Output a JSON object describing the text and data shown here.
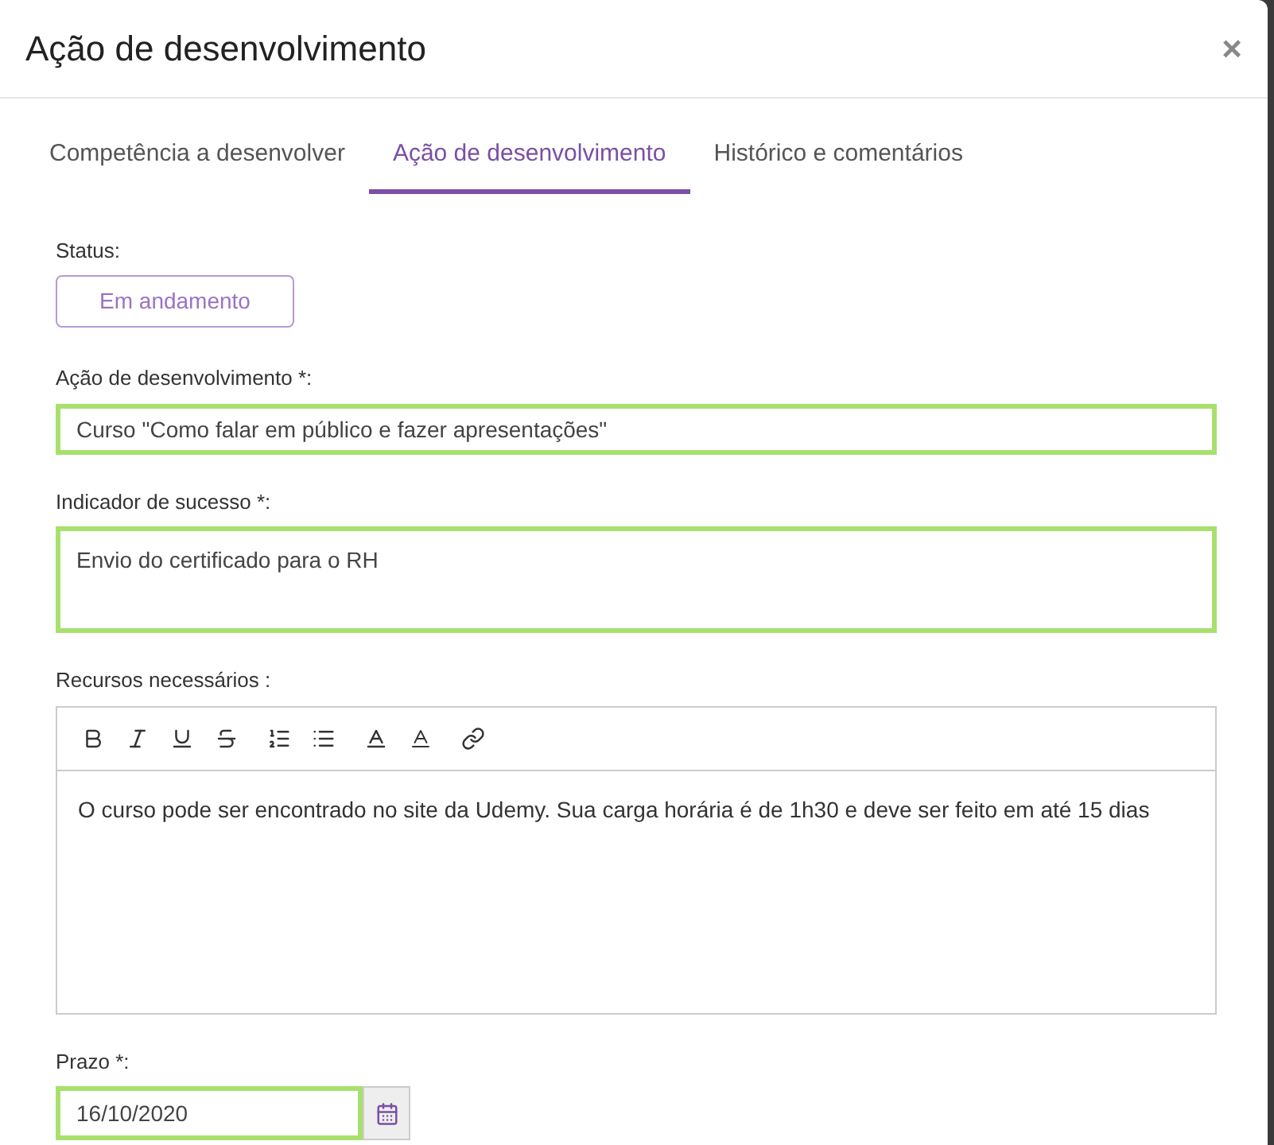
{
  "window": {
    "title": "Ação de desenvolvimento",
    "close": "×"
  },
  "tabs": [
    {
      "label": "Competência a desenvolver",
      "selected": false
    },
    {
      "label": "Ação de desenvolvimento",
      "selected": true
    },
    {
      "label": "Histórico e comentários",
      "selected": false
    }
  ],
  "status": {
    "label": "Status:",
    "value": "Em andamento"
  },
  "action": {
    "label": "Ação de desenvolvimento *:",
    "value": "Curso \"Como falar em público e fazer apresentações\"",
    "valid": true
  },
  "indicator": {
    "label": "Indicador de sucesso *:",
    "value": "Envio do certificado para o RH",
    "valid": true
  },
  "resources": {
    "label": "Recursos necessários :",
    "value": "O curso pode ser encontrado no site da Udemy. Sua carga horária é de 1h30 e deve ser feito em até 15 dias"
  },
  "deadline": {
    "label": "Prazo *:",
    "value": "16/10/2020",
    "valid": true
  }
}
